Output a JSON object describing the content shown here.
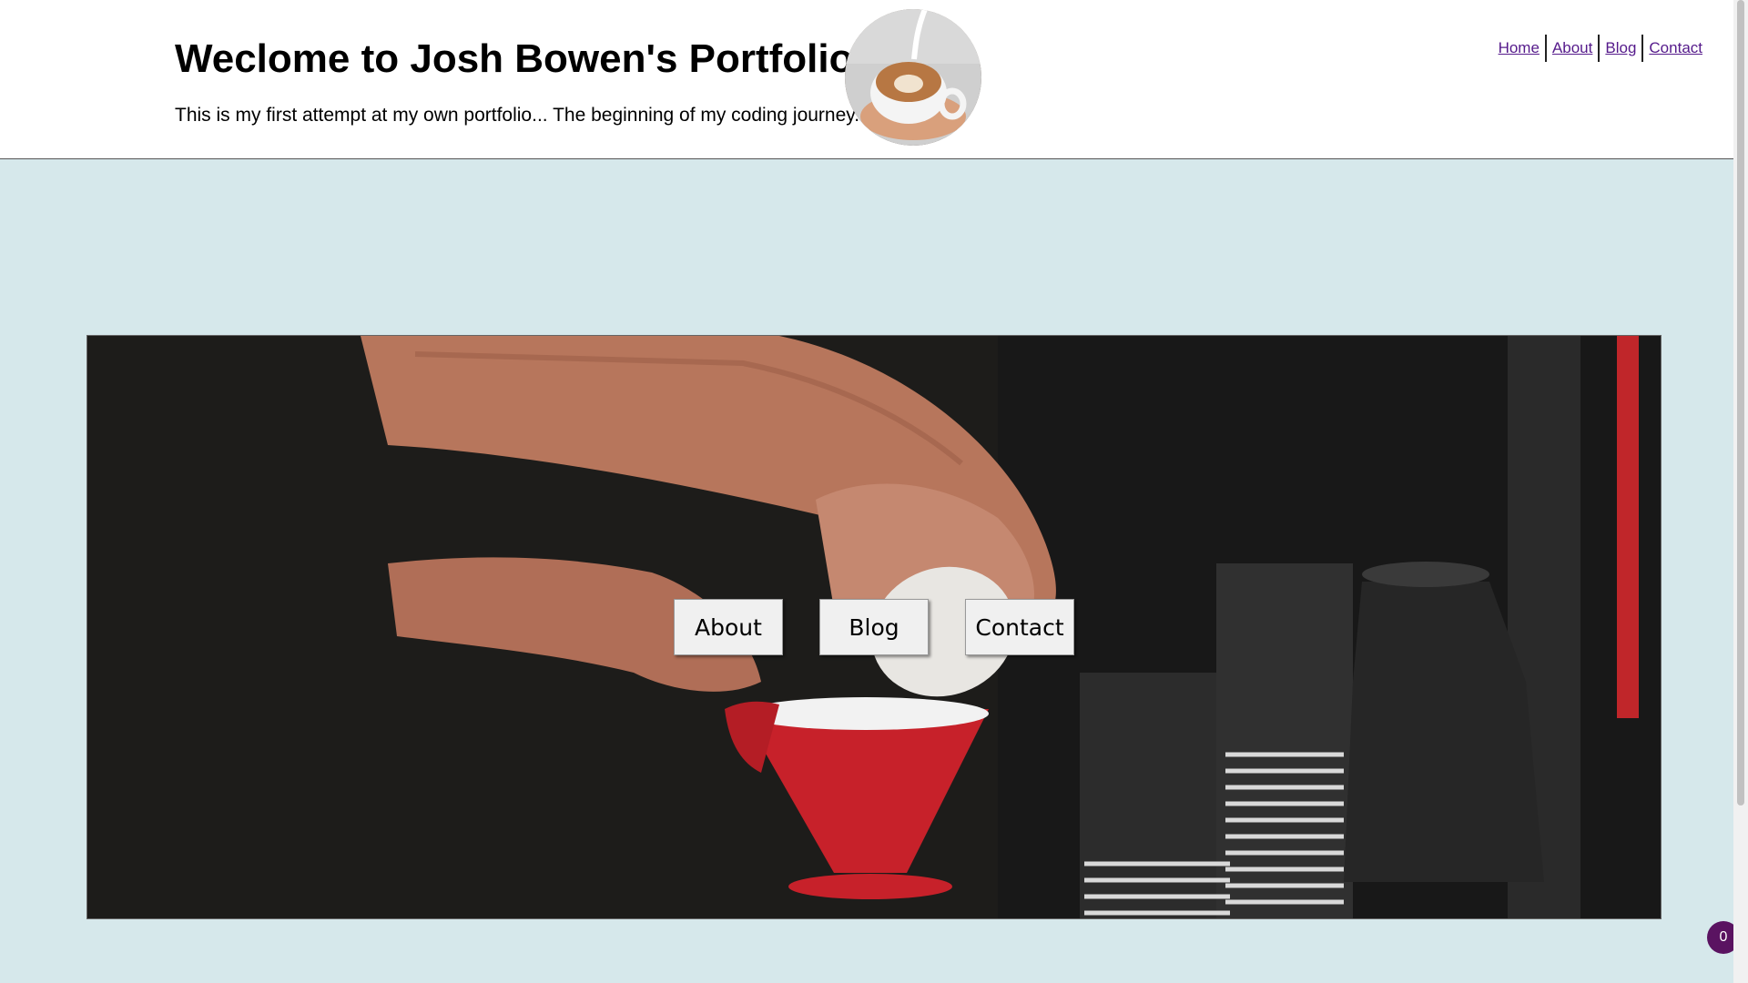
{
  "header": {
    "title": "Weclome to Josh Bowen's Portfolio.",
    "subtitle": "This is my first attempt at my own portfolio... The beginning of my coding journey."
  },
  "nav": {
    "items": [
      {
        "label": "Home"
      },
      {
        "label": "About"
      },
      {
        "label": "Blog"
      },
      {
        "label": "Contact"
      }
    ]
  },
  "hero": {
    "buttons": [
      {
        "label": "About"
      },
      {
        "label": "Blog"
      },
      {
        "label": "Contact"
      }
    ]
  },
  "badge": {
    "count": "0"
  },
  "colors": {
    "page_background": "#d6e8eb",
    "link": "#551a8b",
    "badge": "#5a1361",
    "button_background": "#f0f0f0"
  },
  "images": {
    "logo": "latte-art-cup-photo",
    "hero": "barista-pour-over-coffee-photo"
  }
}
